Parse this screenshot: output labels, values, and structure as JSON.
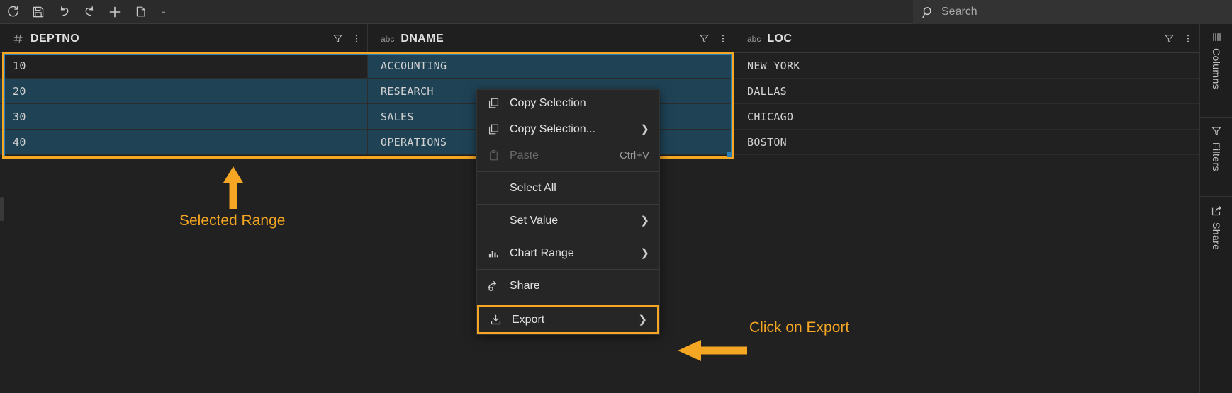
{
  "toolbar": {
    "buttons": [
      {
        "name": "refresh-icon",
        "title": "Refresh"
      },
      {
        "name": "save-icon",
        "title": "Save"
      },
      {
        "name": "undo-icon",
        "title": "Undo"
      },
      {
        "name": "redo-icon",
        "title": "Redo"
      },
      {
        "name": "add-row-icon",
        "title": "Add Row"
      },
      {
        "name": "duplicate-row-icon",
        "title": "Duplicate Row"
      }
    ],
    "minus_label": "-"
  },
  "search": {
    "placeholder": "Search",
    "value": ""
  },
  "grid": {
    "columns": [
      {
        "name": "DEPTNO",
        "type_icon": "hash-icon",
        "type_label": "#"
      },
      {
        "name": "DNAME",
        "type_icon": "abc-icon",
        "type_label": "abc"
      },
      {
        "name": "LOC",
        "type_icon": "abc-icon",
        "type_label": "abc"
      }
    ],
    "rows": [
      {
        "DEPTNO": "10",
        "DNAME": "ACCOUNTING",
        "LOC": "NEW YORK"
      },
      {
        "DEPTNO": "20",
        "DNAME": "RESEARCH",
        "LOC": "DALLAS"
      },
      {
        "DEPTNO": "30",
        "DNAME": "SALES",
        "LOC": "CHICAGO"
      },
      {
        "DEPTNO": "40",
        "DNAME": "OPERATIONS",
        "LOC": "BOSTON"
      }
    ]
  },
  "context_menu": {
    "items": [
      {
        "label": "Copy Selection",
        "icon": "copy-icon",
        "shortcut": "",
        "submenu": false,
        "disabled": false
      },
      {
        "label": "Copy Selection...",
        "icon": "copy-icon",
        "shortcut": "",
        "submenu": true,
        "disabled": false
      },
      {
        "label": "Paste",
        "icon": "paste-icon",
        "shortcut": "Ctrl+V",
        "submenu": false,
        "disabled": true
      },
      {
        "label": "Select All",
        "icon": "",
        "shortcut": "",
        "submenu": false,
        "disabled": false
      },
      {
        "label": "Set Value",
        "icon": "",
        "shortcut": "",
        "submenu": true,
        "disabled": false
      },
      {
        "label": "Chart Range",
        "icon": "chart-icon",
        "shortcut": "",
        "submenu": true,
        "disabled": false
      },
      {
        "label": "Share",
        "icon": "share-icon",
        "shortcut": "",
        "submenu": false,
        "disabled": false
      },
      {
        "label": "Export",
        "icon": "export-icon",
        "shortcut": "",
        "submenu": true,
        "disabled": false,
        "highlighted": true
      }
    ]
  },
  "sidebar": {
    "items": [
      {
        "label": "Columns",
        "icon": "columns-icon"
      },
      {
        "label": "Filters",
        "icon": "filter-icon"
      },
      {
        "label": "Share",
        "icon": "share-icon"
      }
    ]
  },
  "annotations": {
    "selected_range": "Selected Range",
    "click_on_export": "Click on Export",
    "accent_color": "#f5a623",
    "selection_fill": "#1f4355",
    "selection_border": "#2b7fb8"
  }
}
